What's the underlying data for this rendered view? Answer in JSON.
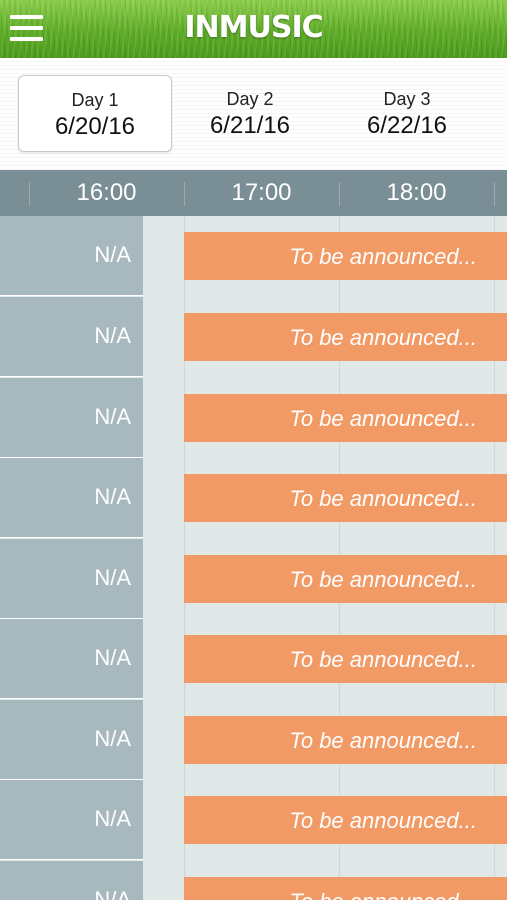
{
  "header": {
    "logo_text": "INMUSIC",
    "menu_icon": "hamburger-menu-icon"
  },
  "days": [
    {
      "label": "Day 1",
      "date": "6/20/16",
      "selected": true
    },
    {
      "label": "Day 2",
      "date": "6/21/16",
      "selected": false
    },
    {
      "label": "Day 3",
      "date": "6/22/16",
      "selected": false
    }
  ],
  "timeline": {
    "times": [
      "16:00",
      "17:00",
      "18:00"
    ]
  },
  "stages": [
    {
      "name": "N/A",
      "slot_text": "To be announced..."
    },
    {
      "name": "N/A",
      "slot_text": "To be announced..."
    },
    {
      "name": "N/A",
      "slot_text": "To be announced..."
    },
    {
      "name": "N/A",
      "slot_text": "To be announced..."
    },
    {
      "name": "N/A",
      "slot_text": "To be announced..."
    },
    {
      "name": "N/A",
      "slot_text": "To be announced..."
    },
    {
      "name": "N/A",
      "slot_text": "To be announced..."
    },
    {
      "name": "N/A",
      "slot_text": "To be announced..."
    },
    {
      "name": "N/A",
      "slot_text": "To be announced..."
    }
  ],
  "colors": {
    "header_green": "#5eac26",
    "timeline_bar": "#7a8e95",
    "stage_column": "#a8b8bf",
    "grid_background": "#e1e8e8",
    "slot_orange": "#f29a65"
  }
}
